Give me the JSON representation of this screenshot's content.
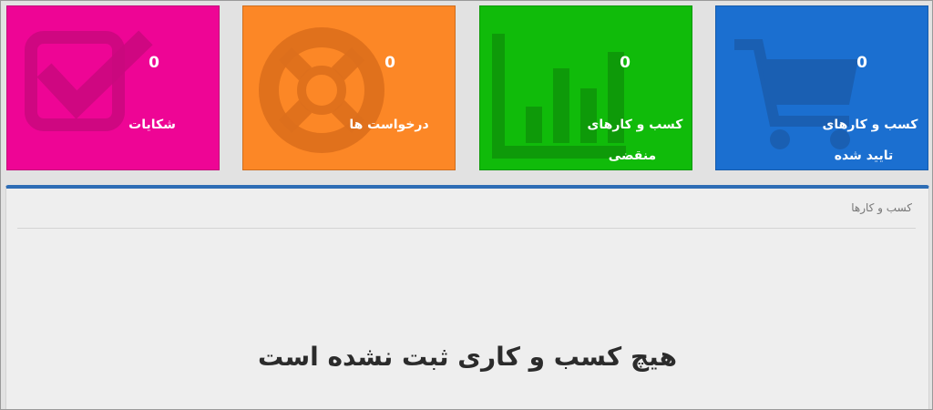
{
  "colors": {
    "complaints": "#ee0595",
    "requests": "#fc8726",
    "expired": "#10bb0a",
    "approved": "#1b6fd0",
    "panel_accent": "#2e6db5"
  },
  "tiles": [
    {
      "key": "approved",
      "count": "0",
      "label_line1": "کسب و کارهای",
      "label_line2": "تایید شده",
      "icon": "shopping-cart-icon"
    },
    {
      "key": "expired",
      "count": "0",
      "label_line1": "کسب و کارهای",
      "label_line2": "منقضی",
      "icon": "bar-chart-icon"
    },
    {
      "key": "requests",
      "count": "0",
      "label_line1": "درخواست ها",
      "label_line2": "",
      "icon": "life-ring-icon"
    },
    {
      "key": "complaints",
      "count": "0",
      "label_line1": "شکایات",
      "label_line2": "",
      "icon": "checkbox-icon"
    }
  ],
  "panel": {
    "title": "کسب و کارها",
    "empty_message": "هیچ کسب و کاری ثبت نشده است"
  }
}
